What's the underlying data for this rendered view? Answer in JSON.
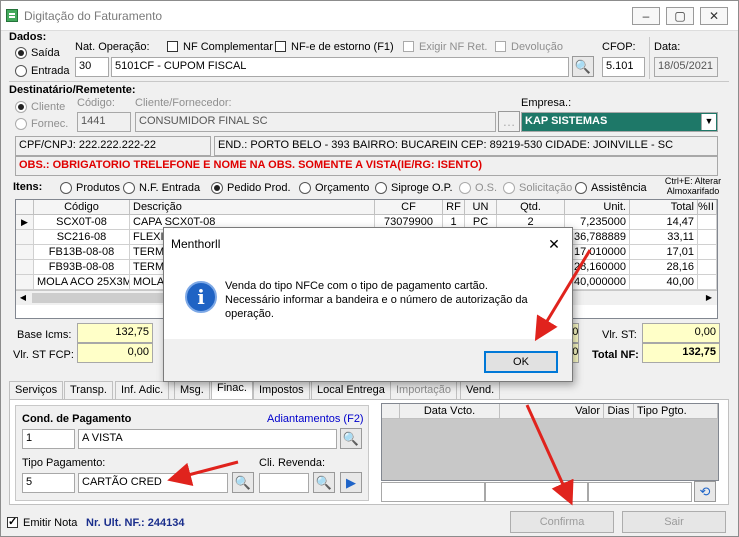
{
  "window": {
    "title": "Digitação do Faturamento",
    "min": "–",
    "max": "▢",
    "close": "✕"
  },
  "dados": {
    "label": "Dados:",
    "saida": "Saída",
    "entrada": "Entrada",
    "nat_op_label": "Nat. Operação:",
    "nat_code": "30",
    "nat_desc": "5101CF - CUPOM FISCAL",
    "nf_complementar": "NF Complementar",
    "nfe_estorno": "NF-e de estorno (F1)",
    "exigir_nf": "Exigir NF Ret.",
    "devolucao": "Devolução",
    "cfop_label": "CFOP:",
    "cfop": "5.101",
    "data_label": "Data:",
    "data": "18/05/2021"
  },
  "dest": {
    "label": "Destinatário/Remetente:",
    "cliente": "Cliente",
    "fornec": "Fornec.",
    "codigo_label": "Código:",
    "codigo": "1441",
    "cli_label": "Cliente/Fornecedor:",
    "cli": "CONSUMIDOR FINAL SC",
    "empresa_label": "Empresa.:",
    "empresa": "KAP SISTEMAS",
    "cpf": "CPF/CNPJ: 222.222.222-22",
    "end": "END.: PORTO BELO - 393 BAIRRO: BUCAREIN CEP: 89219-530 CIDADE: JOINVILLE - SC",
    "obs": "OBS.: OBRIGATORIO TRELEFONE E NOME NA OBS. SOMENTE A VISTA(IE/RG: ISENTO)"
  },
  "itens": {
    "label": "Itens:",
    "options": [
      "Produtos",
      "N.F. Entrada",
      "Pedido Prod.",
      "Orçamento",
      "Siproge O.P.",
      "O.S.",
      "Solicitação",
      "Assistência"
    ],
    "hint_line1": "Ctrl+E: Alterar",
    "hint_line2": "Almoxarifado"
  },
  "grid": {
    "headers": [
      "Código",
      "Descrição",
      "CF",
      "RF",
      "UN",
      "Qtd.",
      "Unit.",
      "Total",
      "%II"
    ],
    "rows": [
      [
        "SCX0T-08",
        "CAPA SCX0T-08",
        "73079900",
        "1",
        "PC",
        "2",
        "7,235000",
        "14,47"
      ],
      [
        "SC216-08",
        "FLEXI",
        "",
        "",
        "",
        "",
        "36,788889",
        "33,11"
      ],
      [
        "FB13B-08-08",
        "TERMI",
        "",
        "",
        "",
        "",
        "17,010000",
        "17,01"
      ],
      [
        "FB93B-08-08",
        "TERMI",
        "",
        "",
        "",
        "",
        "28,160000",
        "28,16"
      ],
      [
        "MOLA ACO 25X3MM",
        "MOLA",
        "",
        "",
        "",
        "",
        "40,000000",
        "40,00"
      ]
    ]
  },
  "totals": {
    "base_icms_label": "Base Icms:",
    "base_icms": "132,75",
    "vlr_st_fcp_label": "Vlr. ST FCP:",
    "vlr_st_fcp": "0,00",
    "vlr_st_label": "Vlr. ST:",
    "vlr_st": "0,00",
    "total_nf_label": "Total NF:",
    "total_nf": "132,75",
    "cut1": "0,00",
    "cut2": "0,00"
  },
  "tabs": [
    "Serviços",
    "Transp.",
    "Inf. Adic.",
    "Msg.",
    "Finac.",
    "Impostos",
    "Local Entrega",
    "Importação",
    "Vend."
  ],
  "payment": {
    "cond_label": "Cond. de Pagamento",
    "adiantamentos": "Adiantamentos (F2)",
    "cond_code": "1",
    "cond_desc": "A VISTA",
    "tipo_label": "Tipo Pagamento:",
    "tipo_code": "5",
    "tipo_desc": "CARTÃO CRED",
    "revenda_label": "Cli. Revenda:"
  },
  "parcelas": {
    "headers": [
      "Data Vcto.",
      "Valor",
      "Dias",
      "Tipo Pgto."
    ]
  },
  "footer": {
    "emitir": "Emitir Nota",
    "ult_nf": "Nr. Ult. NF.: 244134",
    "confirma": "Confirma",
    "sair": "Sair"
  },
  "dialog": {
    "title": "Menthorll",
    "message_line1": "Venda do tipo NFCe com o tipo de pagamento cartão.",
    "message_line2": "Necessário informar a bandeira e o número de autorização da",
    "message_line3": "operação.",
    "ok": "OK",
    "close": "✕"
  }
}
